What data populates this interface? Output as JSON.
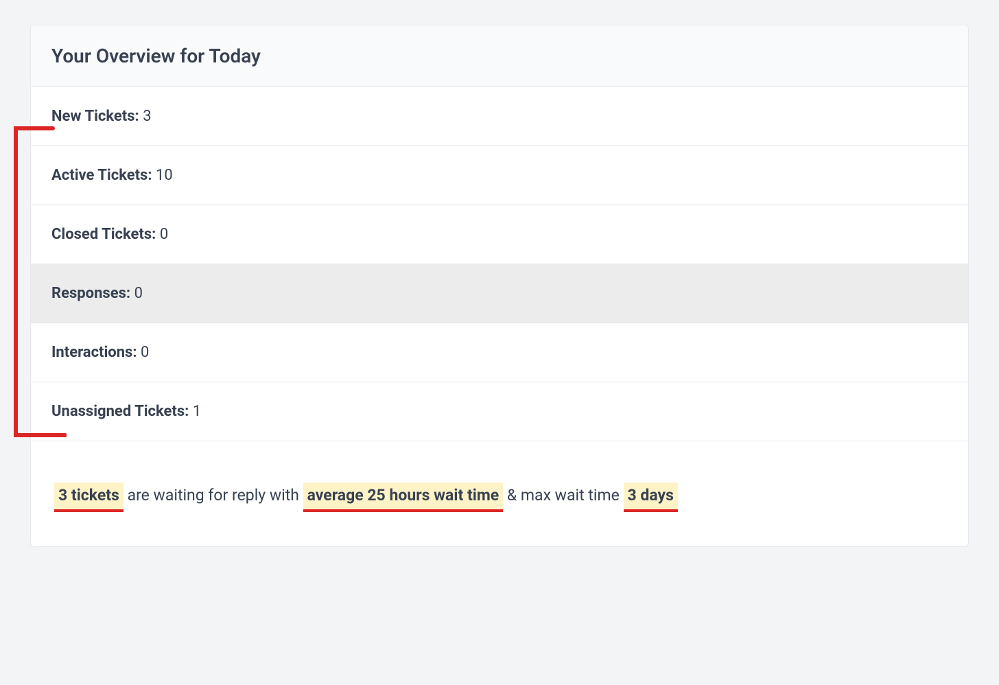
{
  "card": {
    "title": "Your Overview for Today"
  },
  "stats": [
    {
      "label": "New Tickets:",
      "value": "3"
    },
    {
      "label": "Active Tickets:",
      "value": "10"
    },
    {
      "label": "Closed Tickets:",
      "value": "0"
    },
    {
      "label": "Responses:",
      "value": "0"
    },
    {
      "label": "Interactions:",
      "value": "0"
    },
    {
      "label": "Unassigned Tickets:",
      "value": "1"
    }
  ],
  "summary": {
    "highlight1": "3 tickets",
    "text1": " are waiting for reply with ",
    "highlight2": "average 25 hours wait time",
    "text2": " & max wait time ",
    "highlight3": "3 days"
  }
}
